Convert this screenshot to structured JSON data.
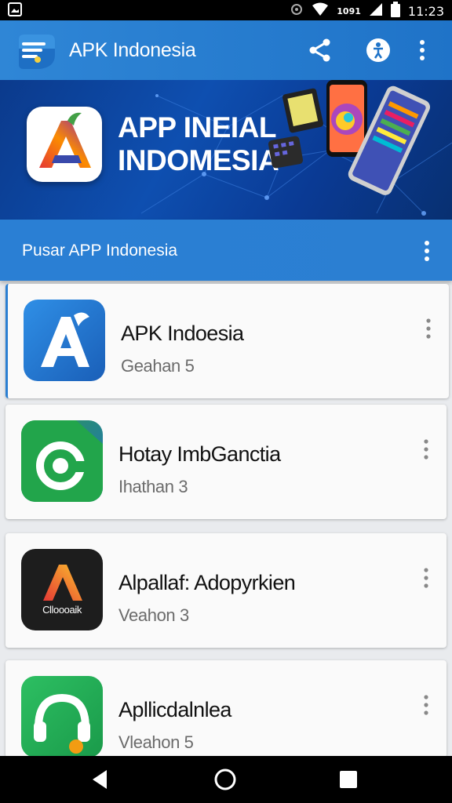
{
  "status_bar": {
    "signal_text": "1091",
    "time": "11:23",
    "icons": [
      "image-icon",
      "vibrate-icon",
      "wifi-icon",
      "signal-icon",
      "battery-icon"
    ]
  },
  "app_bar": {
    "title": "APK Indonesia",
    "icons": [
      "menu-icon",
      "share-icon",
      "accessibility-icon",
      "more-vert-icon"
    ],
    "accent": "#2f86d6"
  },
  "banner": {
    "headline_line1": "APP INEIAL",
    "headline_line2": "INDOMESIA"
  },
  "subheader": {
    "label": "Pusar APP Indonesia"
  },
  "apps": [
    {
      "name": "APK Indoesia",
      "version": "Geahan 5",
      "icon": "apk-a-icon"
    },
    {
      "name": "Hotay ImbGanctia",
      "version": "Ihathan 3",
      "icon": "green-c-icon"
    },
    {
      "name": "Alpallaf: Adopyrkien",
      "version": "Veahon 3",
      "icon_text": "Clloooaik",
      "icon": "colorful-a-icon"
    },
    {
      "name": "Apllicdalnlea",
      "version": "Vleahon 5",
      "icon": "headset-icon"
    }
  ],
  "nav_bar": {
    "icons": [
      "back-icon",
      "home-icon",
      "recents-icon"
    ]
  }
}
